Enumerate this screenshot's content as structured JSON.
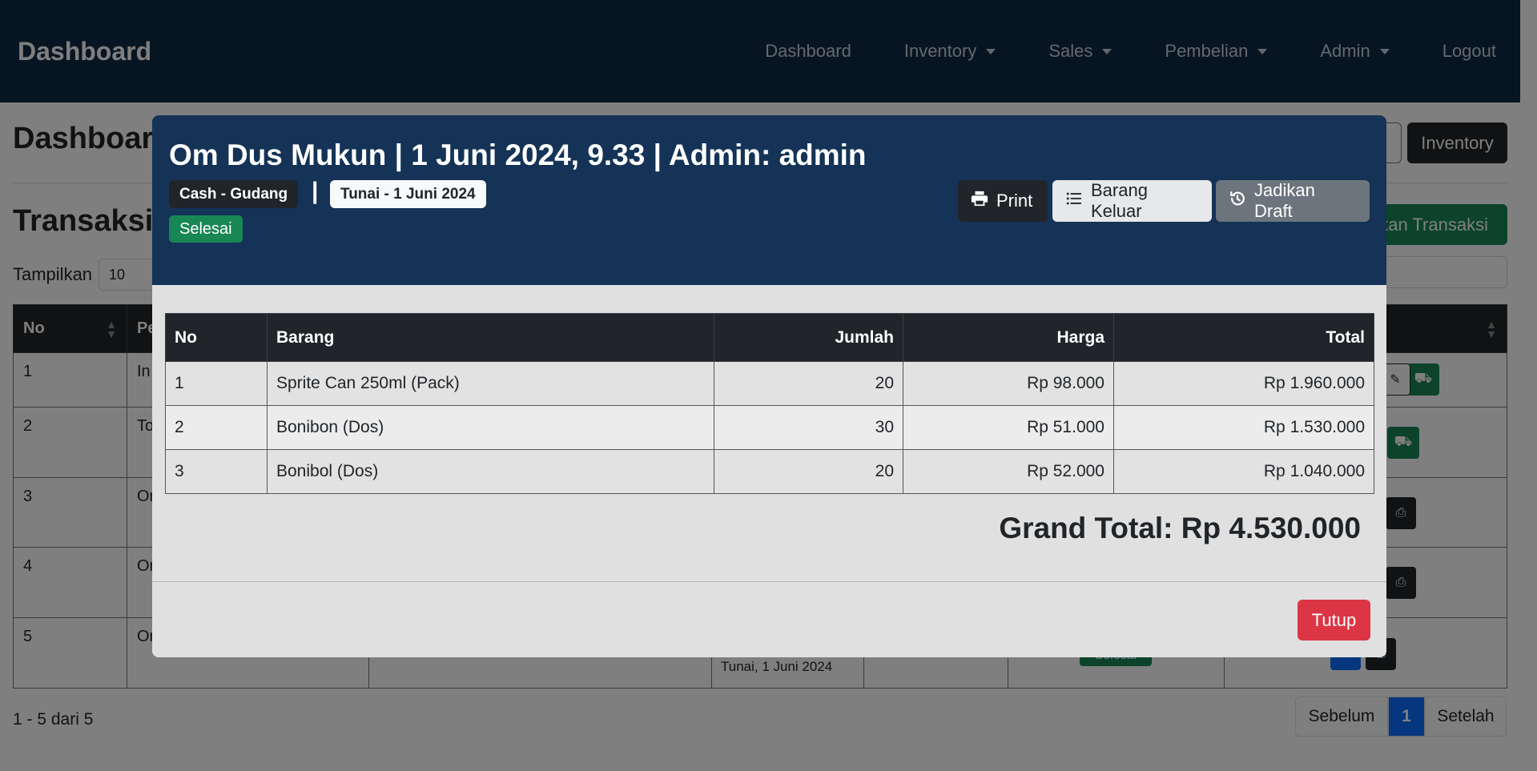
{
  "navbar": {
    "brand": "Dashboard",
    "links": [
      {
        "label": "Dashboard",
        "dropdown": false
      },
      {
        "label": "Inventory",
        "dropdown": true
      },
      {
        "label": "Sales",
        "dropdown": true
      },
      {
        "label": "Pembelian",
        "dropdown": true
      },
      {
        "label": "Admin",
        "dropdown": true
      },
      {
        "label": "Logout",
        "dropdown": false
      }
    ]
  },
  "page": {
    "title": "Dashboard",
    "inventory_button": "Inventory",
    "section_title": "Transaksi I",
    "add_button": "nkan Transaksi",
    "show_label": "Tampilkan",
    "show_value": "10",
    "table_headers": [
      "No",
      "Pe"
    ],
    "rows": [
      {
        "no": "1",
        "col2": "In"
      },
      {
        "no": "2",
        "col2": "To"
      },
      {
        "no": "3",
        "col2": "Or"
      },
      {
        "no": "4",
        "col2": "Or"
      },
      {
        "no": "5",
        "col2": "Or"
      }
    ],
    "row5_payment": "Tunai, 1 Juni 2024",
    "row5_status": "Selesai",
    "pagination_info": "1 - 5 dari 5",
    "pagination": {
      "prev": "Sebelum",
      "current": "1",
      "next": "Setelah"
    }
  },
  "modal": {
    "title": "Om Dus Mukun | 1 Juni 2024, 9.33 | Admin: admin",
    "badge_account": "Cash - Gudang",
    "separator": "|",
    "badge_payment": "Tunai - 1 Juni 2024",
    "badge_status": "Selesai",
    "buttons": {
      "print": "Print",
      "barang_keluar": "Barang Keluar",
      "draft": "Jadikan Draft",
      "close": "Tutup"
    },
    "table": {
      "headers": {
        "no": "No",
        "barang": "Barang",
        "jumlah": "Jumlah",
        "harga": "Harga",
        "total": "Total"
      },
      "rows": [
        {
          "no": "1",
          "barang": "Sprite Can 250ml (Pack)",
          "jumlah": "20",
          "harga": "Rp 98.000",
          "total": "Rp 1.960.000"
        },
        {
          "no": "2",
          "barang": "Bonibon (Dos)",
          "jumlah": "30",
          "harga": "Rp 51.000",
          "total": "Rp 1.530.000"
        },
        {
          "no": "3",
          "barang": "Bonibol (Dos)",
          "jumlah": "20",
          "harga": "Rp 52.000",
          "total": "Rp 1.040.000"
        }
      ]
    },
    "grand_total": "Grand Total: Rp 4.530.000"
  },
  "colors": {
    "navbar_bg": "#0e2a47",
    "modal_header_bg": "#143356",
    "success": "#198754",
    "danger": "#dc3545",
    "secondary": "#6c757d",
    "dark": "#212529"
  },
  "icons": [
    "printer-icon",
    "list-icon",
    "history-icon",
    "caret-down-icon",
    "sort-icon",
    "truck-icon"
  ]
}
